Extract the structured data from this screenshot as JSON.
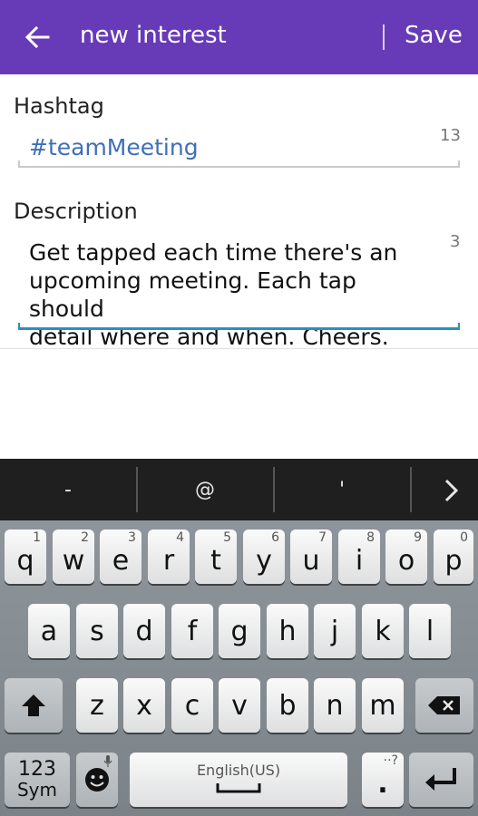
{
  "appbar": {
    "title": "new interest",
    "save_label": "Save",
    "color": "#673ab7"
  },
  "form": {
    "hashtag": {
      "label": "Hashtag",
      "value": "#teamMeeting",
      "counter": "13"
    },
    "description": {
      "label": "Description",
      "lines": [
        "Get tapped each time there's an",
        "upcoming meeting. Each tap should",
        "detail where and when. Cheers."
      ],
      "counter": "3"
    }
  },
  "suggestions": [
    "-",
    "@",
    "'"
  ],
  "keyboard": {
    "row1": [
      [
        "q",
        "1"
      ],
      [
        "w",
        "2"
      ],
      [
        "e",
        "3"
      ],
      [
        "r",
        "4"
      ],
      [
        "t",
        "5"
      ],
      [
        "y",
        "6"
      ],
      [
        "u",
        "7"
      ],
      [
        "i",
        "8"
      ],
      [
        "o",
        "9"
      ],
      [
        "p",
        "0"
      ]
    ],
    "row2": [
      "a",
      "s",
      "d",
      "f",
      "g",
      "h",
      "j",
      "k",
      "l"
    ],
    "row3": [
      "z",
      "x",
      "c",
      "v",
      "b",
      "n",
      "m"
    ],
    "sym_line1": "123",
    "sym_line2": "Sym",
    "space_label": "English(US)",
    "period": ".",
    "period_hint": "··?"
  }
}
